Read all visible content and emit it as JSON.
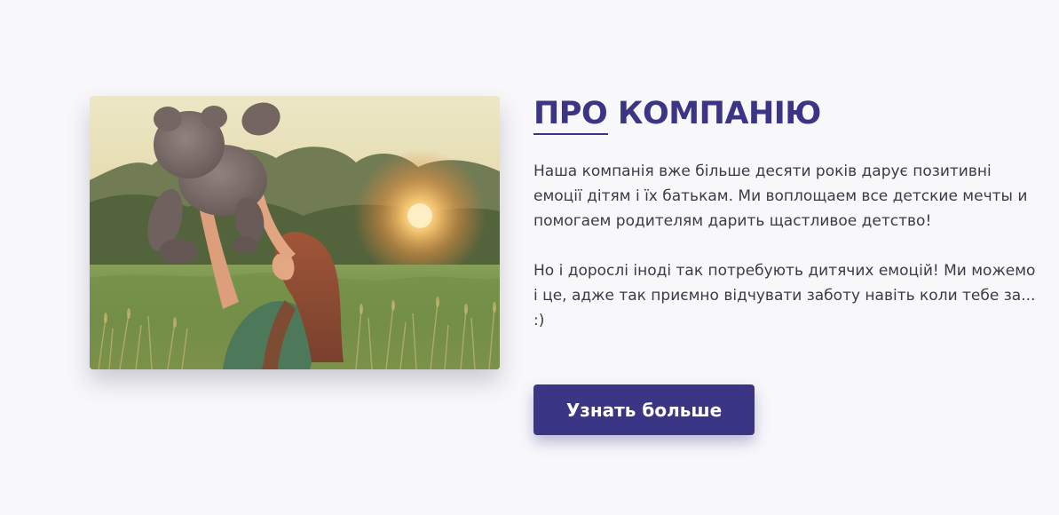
{
  "about": {
    "image_alt": "Girl in a field lifting a teddy bear at sunset",
    "title": "ПРО КОМПАНІЮ",
    "paragraph_1": "Наша компанія вже більше десяти років дарує позитивні емоції дітям і їх батькам. Ми воплощаем все детские мечты и помогаем родителям дарить щастливое детство!",
    "paragraph_2": "Но і дорослі іноді так потребують дитячих емоцій! Ми можемо і це, адже так приємно відчувати заботу навіть коли тебе за... :)",
    "button_label": "Узнать больше"
  },
  "colors": {
    "accent": "#3b3585",
    "background": "#f8f8fb",
    "text": "#3b3b47"
  }
}
